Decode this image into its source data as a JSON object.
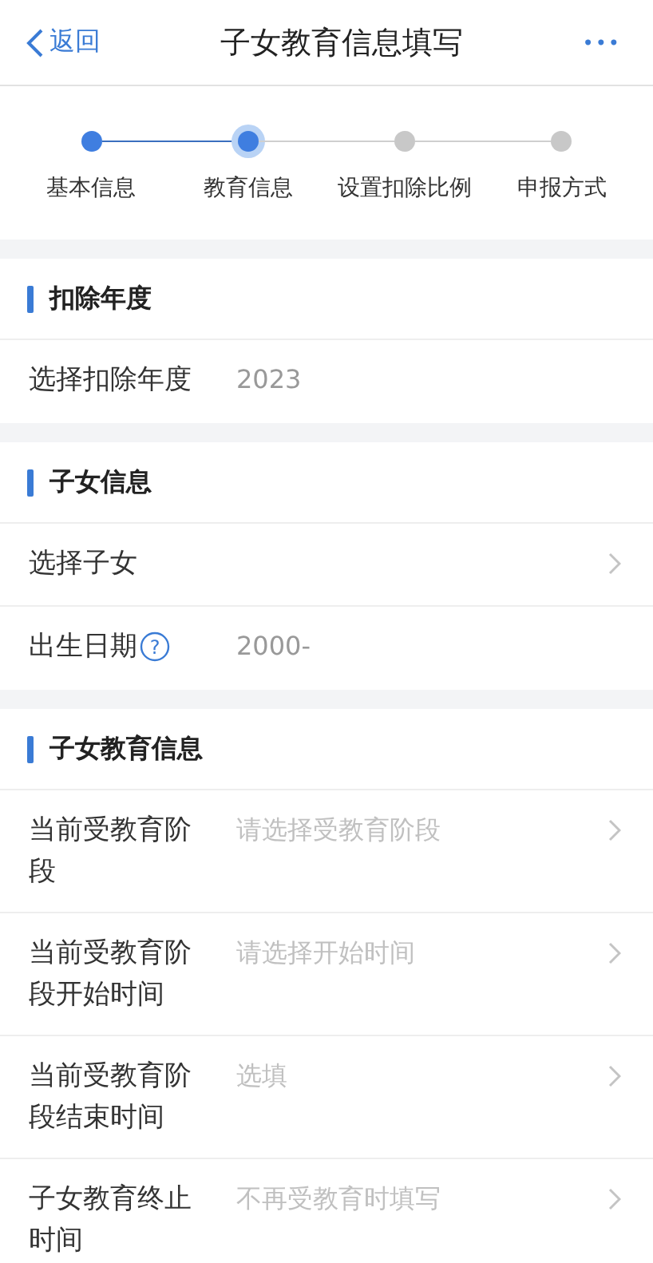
{
  "nav": {
    "back": "返回",
    "title": "子女教育信息填写",
    "more": "•••"
  },
  "steps": [
    {
      "label": "基本信息",
      "done": true,
      "selected": false
    },
    {
      "label": "教育信息",
      "done": false,
      "selected": true
    },
    {
      "label": "设置扣除比例",
      "done": false,
      "selected": false
    },
    {
      "label": "申报方式",
      "done": false,
      "selected": false
    }
  ],
  "sections": [
    {
      "title": "扣除年度",
      "rows": [
        {
          "label": "选择扣除年度",
          "value": "2023",
          "help": false,
          "chevron": false
        }
      ]
    },
    {
      "title": "子女信息",
      "rows": [
        {
          "label": "选择子女",
          "help": false,
          "chevron": true
        },
        {
          "label": "出生日期",
          "value": "2000-",
          "help": "?",
          "chevron": false
        }
      ]
    },
    {
      "title": "子女教育信息",
      "rows": [
        {
          "label": "当前受教育阶段",
          "placeholder": "请选择受教育阶段",
          "help": false,
          "chevron": true
        },
        {
          "label": "当前受教育阶段开始时间",
          "placeholder": "请选择开始时间",
          "help": false,
          "chevron": true
        },
        {
          "label": "当前受教育阶段结束时间",
          "placeholder": "选填",
          "help": false,
          "chevron": true
        },
        {
          "label": "子女教育终止时间",
          "placeholder": "不再受教育时填写",
          "help": false,
          "chevron": true
        }
      ]
    }
  ]
}
